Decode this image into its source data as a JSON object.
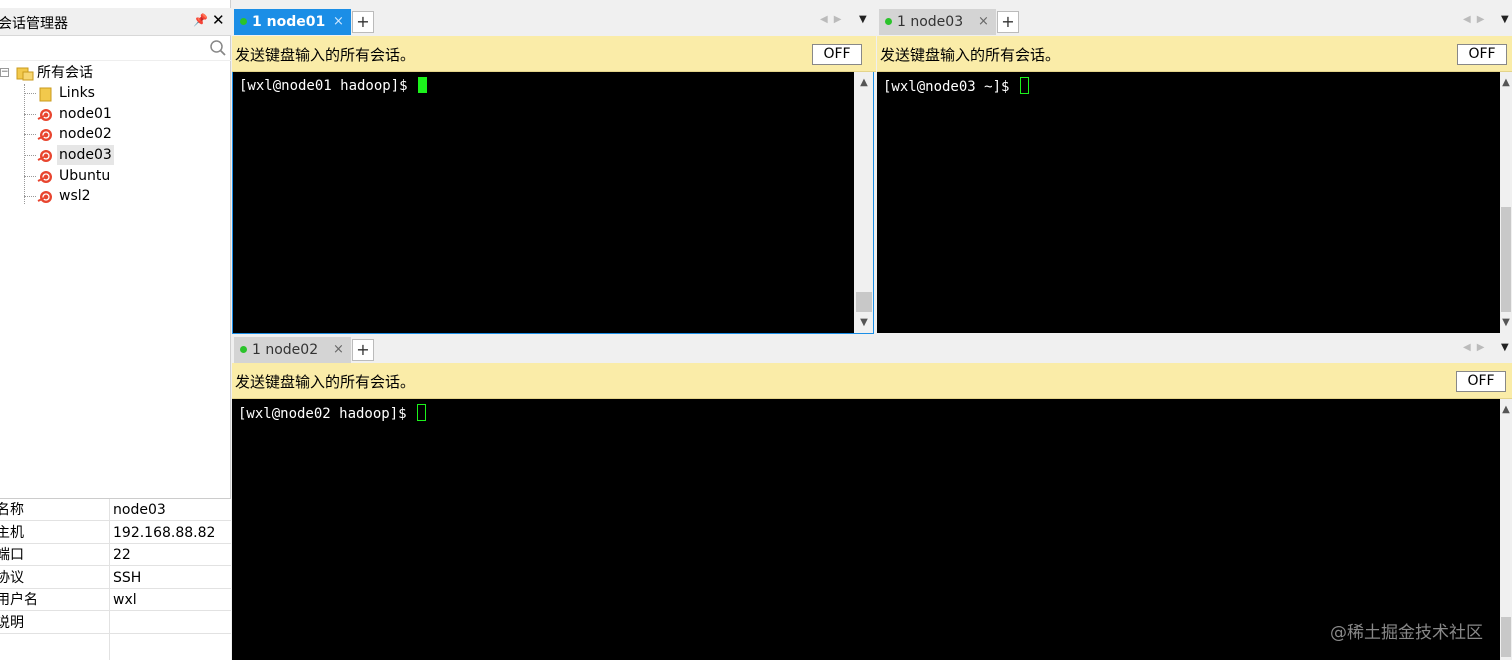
{
  "session_manager": {
    "title": "会话管理器",
    "pin_icon": "pin-icon",
    "close_icon": "close-icon",
    "search_icon": "search-icon",
    "tree": {
      "root": "所有会话",
      "items": [
        {
          "label": "Links",
          "icon": "folder-icon"
        },
        {
          "label": "node01",
          "icon": "session-icon"
        },
        {
          "label": "node02",
          "icon": "session-icon"
        },
        {
          "label": "node03",
          "icon": "session-icon",
          "selected": true
        },
        {
          "label": "Ubuntu",
          "icon": "session-icon"
        },
        {
          "label": "wsl2",
          "icon": "session-icon"
        }
      ]
    },
    "properties": [
      {
        "key": "名称",
        "value": "node03"
      },
      {
        "key": "主机",
        "value": "192.168.88.82"
      },
      {
        "key": "端口",
        "value": "22"
      },
      {
        "key": "协议",
        "value": "SSH"
      },
      {
        "key": "用户名",
        "value": "wxl"
      },
      {
        "key": "说明",
        "value": ""
      }
    ]
  },
  "panes": {
    "top_left": {
      "tab_label": "1 node01",
      "tab_close": "×",
      "new_tab": "+",
      "broadcast_text": "发送键盘输入的所有会话。",
      "broadcast_button": "OFF",
      "prompt": "[wxl@node01 hadoop]$ "
    },
    "top_right": {
      "tab_label": "1 node03",
      "tab_close": "×",
      "new_tab": "+",
      "broadcast_text": "发送键盘输入的所有会话。",
      "broadcast_button": "OFF",
      "prompt": "[wxl@node03 ~]$ "
    },
    "bottom": {
      "tab_label": "1 node02",
      "tab_close": "×",
      "new_tab": "+",
      "broadcast_text": "发送键盘输入的所有会话。",
      "broadcast_button": "OFF",
      "prompt": "[wxl@node02 hadoop]$ "
    }
  },
  "scroll_arrows": {
    "up": "▲",
    "down": "▼",
    "left": "◀",
    "right": "▶",
    "menu": "▼"
  },
  "watermark": "@稀土掘金技术社区",
  "colors": {
    "active_tab": "#1b8ee6",
    "broadcast_bar": "#faeca8",
    "terminal_bg": "#000000",
    "cursor": "#1cf21c",
    "status_dot": "#2bc32b"
  }
}
